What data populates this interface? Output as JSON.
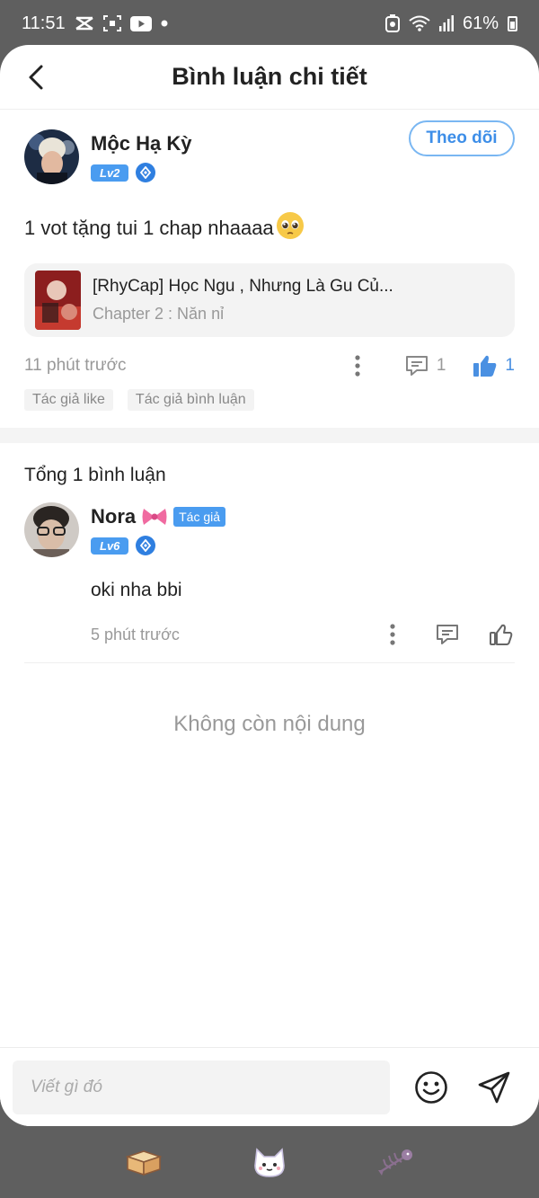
{
  "status_bar": {
    "time": "11:51",
    "battery": "61%"
  },
  "header": {
    "title": "Bình luận chi tiết"
  },
  "post": {
    "author_name": "Mộc Hạ Kỳ",
    "author_level": "Lv2",
    "follow_label": "Theo dõi",
    "text": "1 vot tặng tui 1 chap nhaaaa",
    "chapter": {
      "title": "[RhyCap] Học Ngu , Nhưng Là Gu Củ...",
      "subtitle": "Chapter 2 : Năn nỉ"
    },
    "time": "11 phút trước",
    "comment_count": "1",
    "like_count": "1",
    "tags": [
      "Tác giả like",
      "Tác giả bình luận"
    ]
  },
  "comments": {
    "total_label": "Tổng 1 bình luận",
    "items": [
      {
        "name": "Nora",
        "author_tag": "Tác giả",
        "level": "Lv6",
        "text": "oki nha bbi",
        "time": "5 phút trước"
      }
    ],
    "empty_label": "Không còn nội dung"
  },
  "input": {
    "placeholder": "Viết gì đó"
  },
  "colors": {
    "accent": "#4a90e2",
    "level_badge": "#4a9cf0",
    "nav_bar": "#5f5f5f"
  },
  "icons": {
    "back": "chevron-left-icon",
    "more": "more-vertical-icon",
    "comment": "comment-icon",
    "like": "thumbs-up-icon",
    "emoji": "smiley-icon",
    "send": "send-icon",
    "nav": [
      "box-icon",
      "cat-icon",
      "fish-bone-icon"
    ]
  }
}
